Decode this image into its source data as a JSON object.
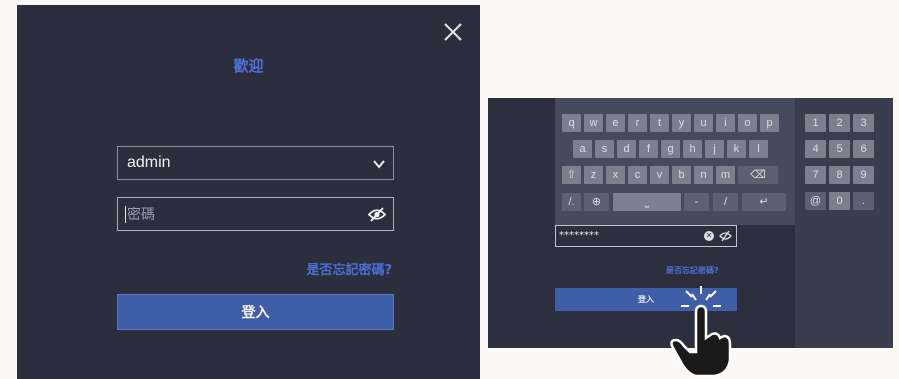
{
  "login_dialog": {
    "title": "歡迎",
    "username_value": "admin",
    "password_placeholder": "密碼",
    "forgot_password_link": "是否忘記密碼?",
    "login_button": "登入"
  },
  "virtual_keyboard": {
    "row1": [
      "q",
      "w",
      "e",
      "r",
      "t",
      "y",
      "u",
      "i",
      "o",
      "p"
    ],
    "row2": [
      "a",
      "s",
      "d",
      "f",
      "g",
      "h",
      "j",
      "k",
      "l"
    ],
    "row3": [
      "z",
      "x",
      "c",
      "v",
      "b",
      "n",
      "m"
    ],
    "row4": [
      "/.",
      "-",
      "/"
    ],
    "numpad": [
      "1",
      "2",
      "3",
      "4",
      "5",
      "6",
      "7",
      "8",
      "9",
      "@",
      "0",
      "."
    ],
    "password_value": "********",
    "forgot_password_link": "是否忘記密碼?",
    "login_button": "登入"
  },
  "colors": {
    "panel_bg": "#2a2e3d",
    "accent_blue": "#4d6fd6",
    "button_blue": "#3f5ea8"
  }
}
